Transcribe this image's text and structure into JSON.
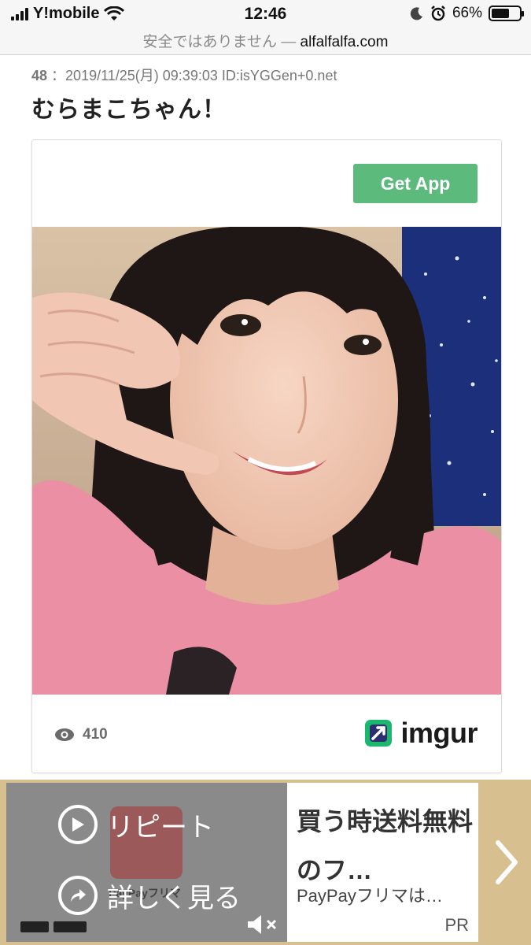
{
  "status": {
    "carrier": "Y!mobile",
    "time": "12:46",
    "battery": "66%",
    "battery_level": 0.66
  },
  "browser": {
    "security_warning": "安全ではありません —",
    "domain": "alfalfalfa.com"
  },
  "post": {
    "number": "48",
    "separator": "：",
    "datetime": "2019/11/25(月) 09:39:03",
    "id": "ID:isYGGen+0.net",
    "text": "むらまこちゃん！"
  },
  "imgur_embed": {
    "get_app_label": "Get App",
    "views": "410",
    "brand": "imgur",
    "colors": {
      "get_app_bg": "#5cba7d",
      "brand_green": "#1bb76e"
    }
  },
  "ad": {
    "replay_label": "リピート",
    "details_label": "詳しく見る",
    "title": "買う時送料無料のフ…",
    "subtitle": "PayPayフリマは…",
    "pr_label": "PR",
    "brand": "PayPayフリマ"
  }
}
